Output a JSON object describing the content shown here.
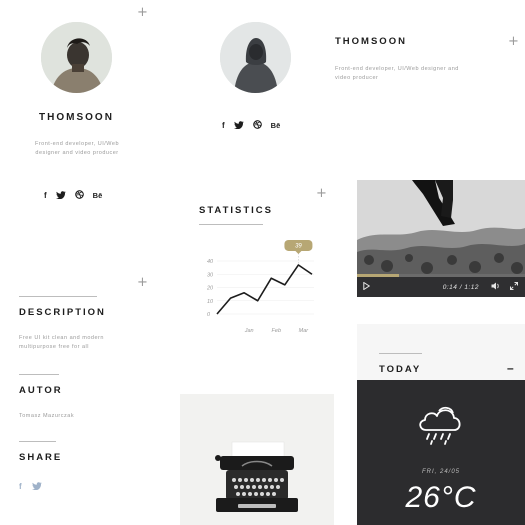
{
  "profile_left": {
    "name": "THOMSOON",
    "bio": "Front-end developer, UI/Web designer and video producer",
    "social": [
      "f",
      "✉",
      "❀",
      "Bē"
    ]
  },
  "profile_center": {
    "social": [
      "f",
      "✉",
      "❀",
      "Bē"
    ]
  },
  "profile_right": {
    "name": "THOMSOON",
    "bio": "Front-end developer, UI/Web designer and video producer"
  },
  "plus_symbol": "+",
  "statistics": {
    "title": "STATISTICS",
    "tooltip": "39"
  },
  "chart_data": {
    "type": "line",
    "categories": [
      "",
      "",
      "Jan",
      "",
      "Feb",
      "",
      "Mar",
      ""
    ],
    "values": [
      0,
      12,
      16,
      10,
      27,
      22,
      37,
      30
    ],
    "ylim": [
      0,
      40
    ],
    "yticks": [
      "0",
      "10",
      "20",
      "30",
      "40"
    ],
    "xtick_labels": [
      "Jan",
      "Feb",
      "Mar"
    ],
    "grid": true,
    "line_color": "#1d1d1d",
    "highlight_value": "39",
    "highlight_color": "#b7a774"
  },
  "video": {
    "time": "0:14 / 1:12",
    "progress_fraction": 0.25
  },
  "description": {
    "title": "DESCRIPTION",
    "text": "Free UI kit clean and modern multipurpose free for all"
  },
  "autor": {
    "title": "AUTOR",
    "text": "Tomasz Mazurczak"
  },
  "share": {
    "title": "SHARE",
    "icons": [
      "f",
      "✉"
    ]
  },
  "today": {
    "title": "TODAY",
    "collapse_symbol": "–"
  },
  "weather": {
    "date": "FRI, 24/05",
    "temperature": "26°C"
  },
  "colors": {
    "accent": "#b7a774",
    "dark_panel": "#2c2c2e",
    "text_dark": "#1d1d1d",
    "text_muted": "#9b9b9b"
  }
}
